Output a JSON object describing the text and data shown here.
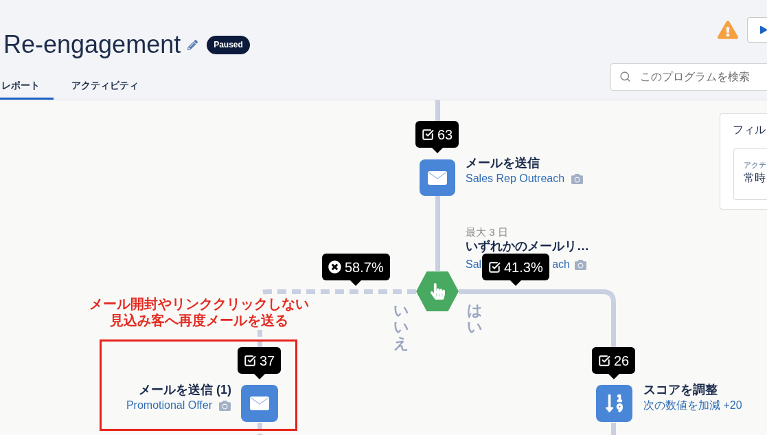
{
  "header": {
    "title": "Re-engagement",
    "status": "Paused"
  },
  "tabs": [
    {
      "label": "レポート",
      "selected": true
    },
    {
      "label": "アクティビティ",
      "selected": false
    }
  ],
  "search": {
    "placeholder": "このプログラムを検索"
  },
  "filter_panel": {
    "title": "フィル",
    "field_label": "アクテ",
    "field_value": "常時"
  },
  "flow": {
    "first_step": {
      "kind": "email",
      "stat": {
        "kind": "completed",
        "value": "63"
      },
      "title": "メールを送信",
      "asset": "Sales Rep Outreach"
    },
    "decision": {
      "wait": "最大 3 日",
      "title": "いずれかのメールリ…",
      "asset_visible_parts": [
        "Sal",
        "ach"
      ],
      "no": {
        "label": "いいえ",
        "stat": {
          "kind": "excluded",
          "value": "58.7%"
        }
      },
      "yes": {
        "label": "はい",
        "stat": {
          "kind": "completed",
          "value": "41.3%"
        }
      }
    },
    "annotation": {
      "lines": [
        "メール開封やリンククリックしない",
        "見込み客へ再度メールを送る"
      ]
    },
    "no_step": {
      "kind": "email",
      "highlighted": true,
      "stat": {
        "kind": "completed",
        "value": "37"
      },
      "title": "メールを送信 (1)",
      "asset": "Promotional Offer"
    },
    "yes_step": {
      "kind": "score",
      "stat": {
        "kind": "completed",
        "value": "26"
      },
      "title": "スコアを調整",
      "asset": "次の数値を加減 +20"
    }
  }
}
